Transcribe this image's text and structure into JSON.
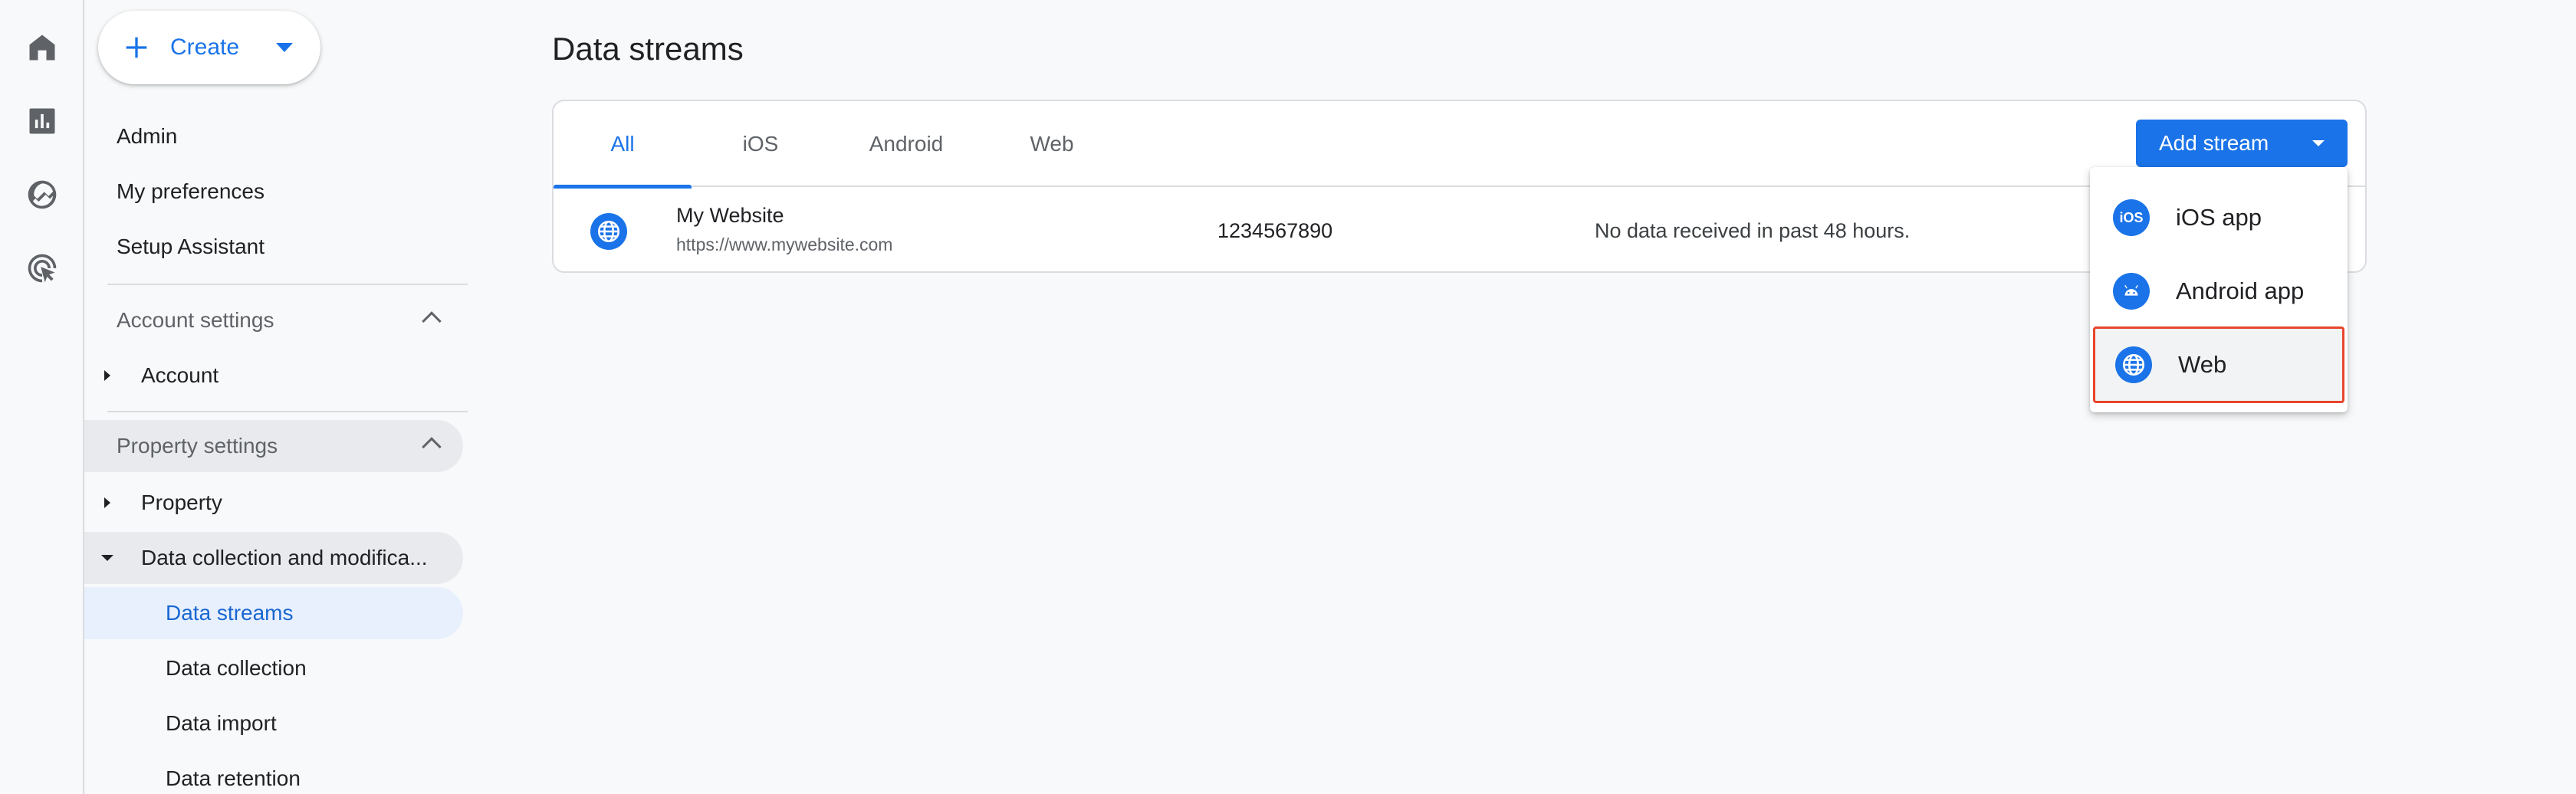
{
  "rail": {
    "icons": [
      "home-icon",
      "reports-icon",
      "explore-icon",
      "advertising-icon"
    ]
  },
  "sidebar": {
    "create_label": "Create",
    "top_items": [
      "Admin",
      "My preferences",
      "Setup Assistant"
    ],
    "account_settings": {
      "header": "Account settings",
      "items": [
        "Account"
      ]
    },
    "property_settings": {
      "header": "Property settings",
      "items": [
        "Property",
        "Data collection and modifica..."
      ],
      "subitems": [
        "Data streams",
        "Data collection",
        "Data import",
        "Data retention"
      ]
    }
  },
  "main": {
    "title": "Data streams",
    "tabs": [
      "All",
      "iOS",
      "Android",
      "Web"
    ],
    "active_tab": "All",
    "add_stream_label": "Add stream",
    "streams": [
      {
        "name": "My Website",
        "url": "https://www.mywebsite.com",
        "id": "1234567890",
        "status": "No data received in past 48 hours."
      }
    ]
  },
  "menu": {
    "items": [
      {
        "label": "iOS app",
        "icon": "ios-icon",
        "icon_text": "iOS"
      },
      {
        "label": "Android app",
        "icon": "android-icon"
      },
      {
        "label": "Web",
        "icon": "globe-icon"
      }
    ],
    "highlighted": "Web"
  },
  "colors": {
    "accent": "#1a73e8",
    "highlight_border": "#e8452c",
    "active_nav_bg": "#e8f0fe"
  }
}
